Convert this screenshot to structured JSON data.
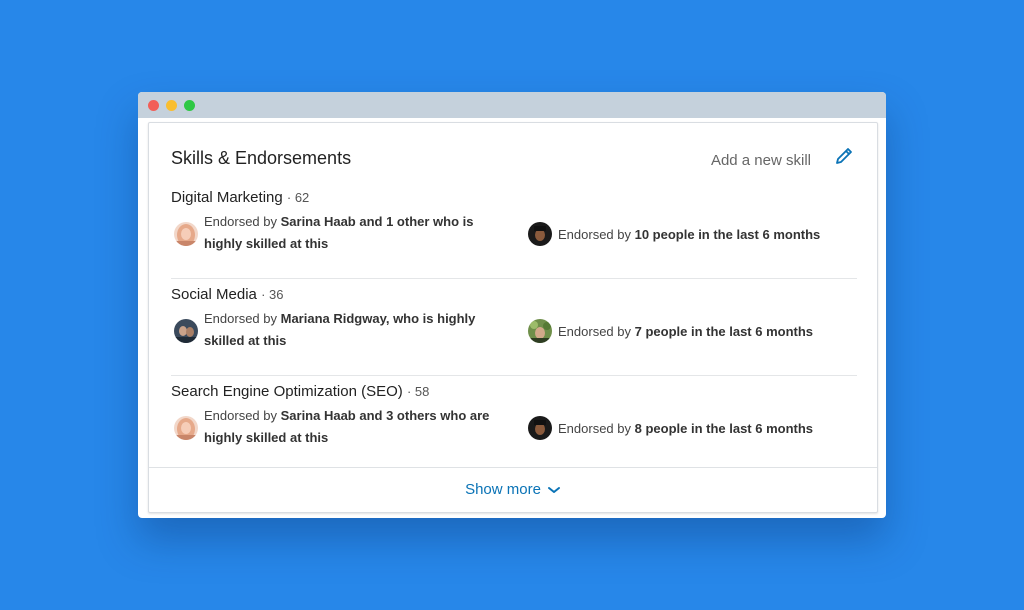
{
  "window": {
    "traffic_lights": [
      "close",
      "minimize",
      "zoom"
    ]
  },
  "card": {
    "title": "Skills & Endorsements",
    "add_skill_label": "Add a new skill",
    "edit_icon": "pencil-icon"
  },
  "skills": [
    {
      "name": "Digital Marketing",
      "count_text": "· 62",
      "endorsed_prefix": "Endorsed by ",
      "highlight_strong": "Sarina Haab and 1 other who is",
      "highlight_rest": "highly skilled at this",
      "recent_prefix": "Endorsed by ",
      "recent_strong": "10 people in the last 6 months"
    },
    {
      "name": "Social Media",
      "count_text": "· 36",
      "endorsed_prefix": "Endorsed by ",
      "highlight_strong": "Mariana Ridgway, who is highly",
      "highlight_rest": "skilled at this",
      "recent_prefix": "Endorsed by ",
      "recent_strong": "7 people in the last 6 months"
    },
    {
      "name": "Search Engine Optimization (SEO)",
      "count_text": "· 58",
      "endorsed_prefix": "Endorsed by ",
      "highlight_strong": "Sarina Haab and 3 others who are",
      "highlight_rest": "highly skilled at this",
      "recent_prefix": "Endorsed by ",
      "recent_strong": "8 people in the last 6 months"
    }
  ],
  "footer": {
    "show_more_label": "Show more",
    "chevron_icon": "chevron-down-icon"
  },
  "colors": {
    "background": "#2787e9",
    "link": "#0a73b6",
    "titlebar": "#c5d1dc"
  }
}
